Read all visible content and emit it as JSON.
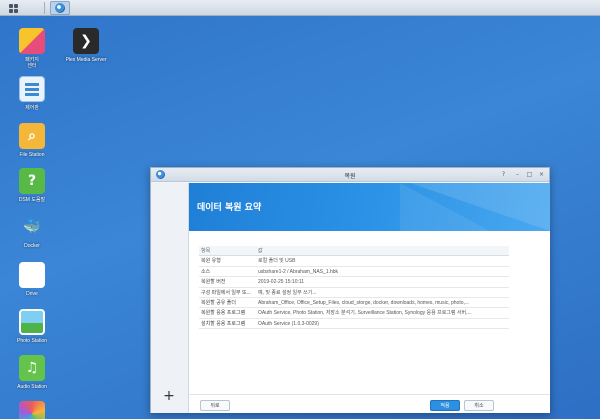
{
  "desktop": {
    "icons": [
      {
        "label": "패키지\n센터"
      },
      {
        "label": "제어판"
      },
      {
        "label": "File Station"
      },
      {
        "label": "DSM 도움말"
      },
      {
        "label": "Docker"
      },
      {
        "label": "Drive"
      },
      {
        "label": "Photo Station"
      },
      {
        "label": "Audio Station"
      },
      {
        "label": ""
      },
      {
        "label": "Plex Media Server"
      }
    ]
  },
  "window": {
    "title": "복원",
    "controls": {
      "help": "?",
      "min": "–",
      "max": "□",
      "close": "×"
    },
    "add_label": "+",
    "banner_title": "데이터 복원 요약",
    "table": {
      "headers": [
        "항목",
        "값"
      ],
      "rows": [
        [
          "복원 유형",
          "로컬 폴더 및 USB"
        ],
        [
          "소스",
          "usbshare1-2 / Abraham_NAS_1.hbk"
        ],
        [
          "복원할 버전",
          "2019-02-25 15:10:11"
        ],
        [
          "구성 파일에서 일부 또...",
          "예, 및 종료 설정 일부 쓰기..."
        ],
        [
          "복원할 공유 폴더",
          "Abraham_Office, Office_Setup_Files, cloud_storge, docker, downloads, homes, music, photo,..."
        ],
        [
          "복원할 응용 프로그램",
          "OAuth Service, Photo Station, 저장소 분석기, Surveillance Station, Synology 응용 프로그램 서버,..."
        ],
        [
          "설치할 응용 프로그램",
          "OAuth Service (1.0.3-0029)"
        ]
      ]
    },
    "buttons": {
      "back": "뒤로",
      "apply": "적용",
      "cancel": "취소"
    }
  }
}
